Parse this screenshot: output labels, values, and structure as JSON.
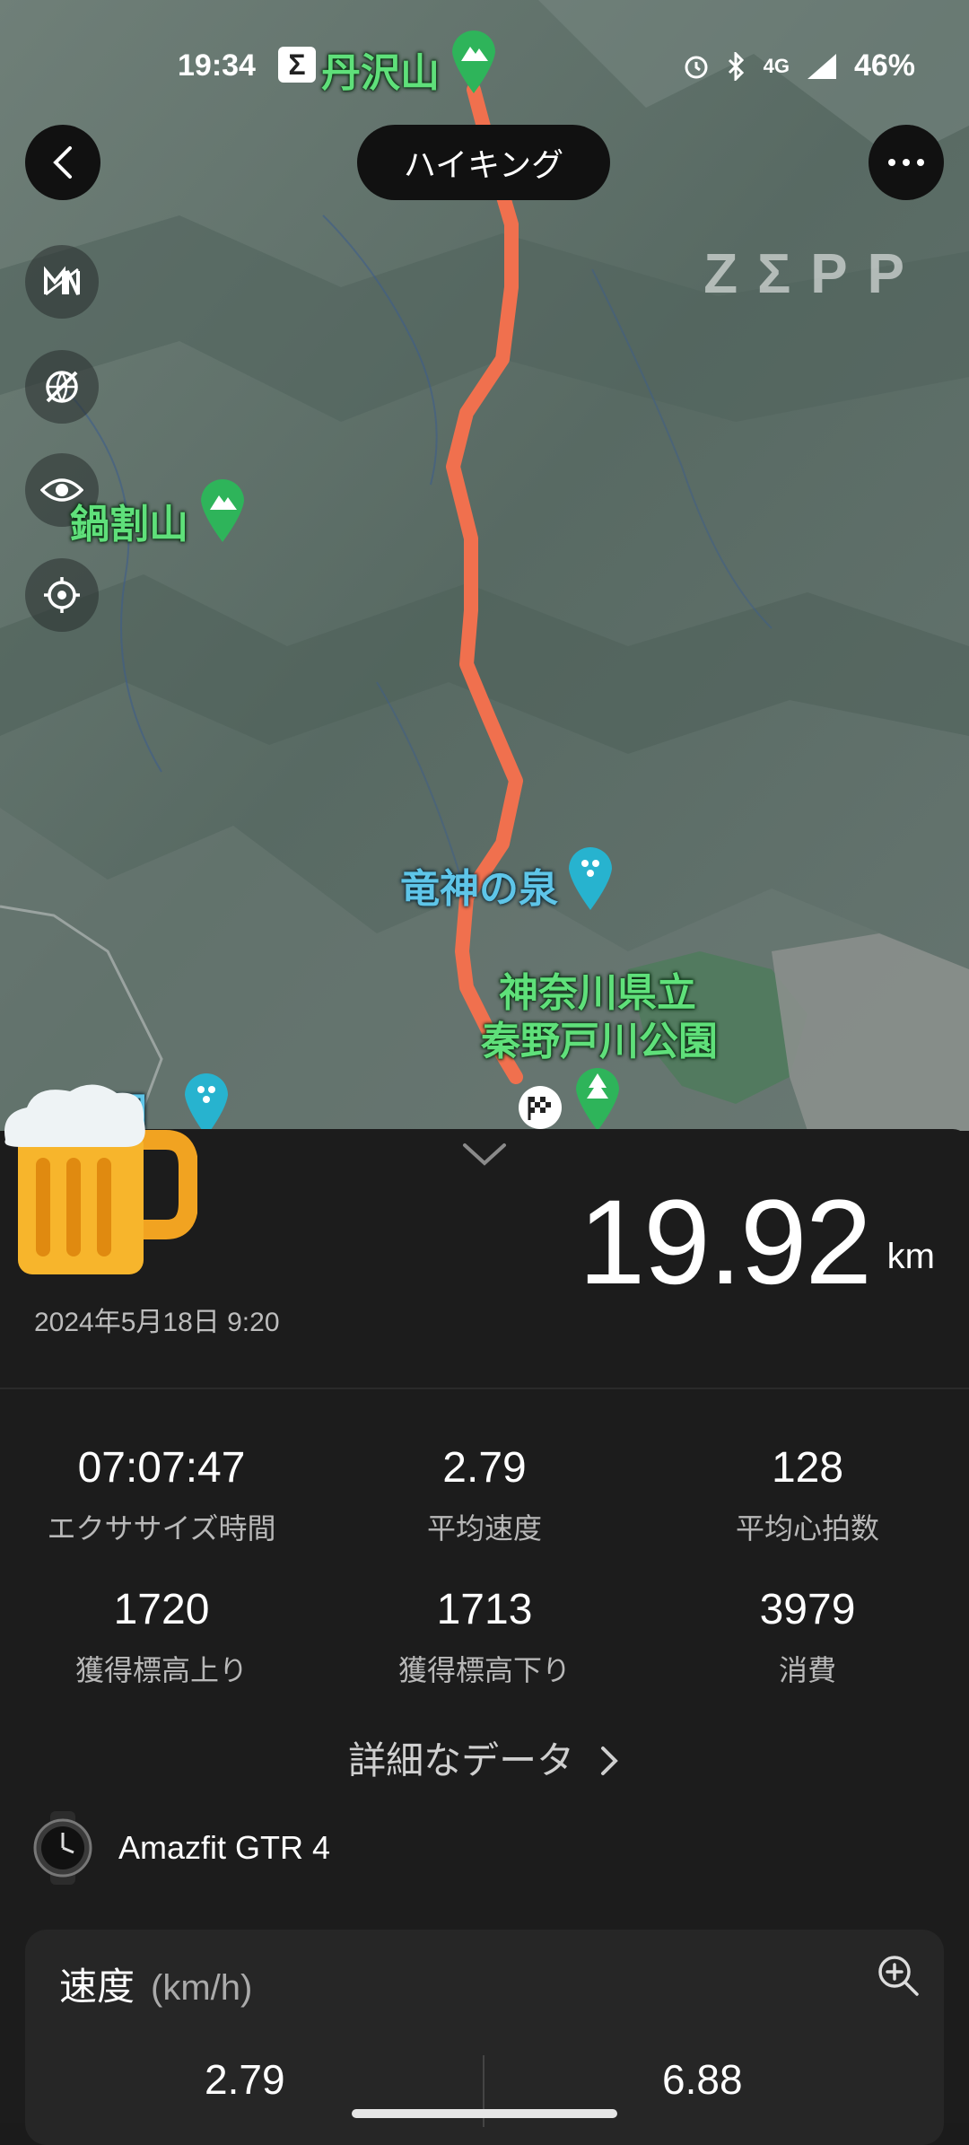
{
  "status_bar": {
    "time": "19:34",
    "notif_icon": "sigma-icon",
    "battery": "46%",
    "network": "4G"
  },
  "map": {
    "activity_title": "ハイキング",
    "watermark": "ZΣPP",
    "places": {
      "tanzawa": "丹沢山",
      "nabewari": "鍋割山",
      "ryujin": "竜神の泉",
      "park_line1": "神奈川県立",
      "park_line2": "秦野戸川公園",
      "left_partial": "園"
    },
    "route_color": "#f0704e"
  },
  "summary": {
    "distance": "19.92",
    "distance_unit": "km",
    "date": "2024年5月18日 9:20"
  },
  "stats": [
    {
      "value": "07:07:47",
      "label": "エクササイズ時間"
    },
    {
      "value": "2.79",
      "label": "平均速度"
    },
    {
      "value": "128",
      "label": "平均心拍数"
    },
    {
      "value": "1720",
      "label": "獲得標高上り"
    },
    {
      "value": "1713",
      "label": "獲得標高下り"
    },
    {
      "value": "3979",
      "label": "消費"
    }
  ],
  "detail_link": "詳細なデータ",
  "device": {
    "name": "Amazfit GTR 4"
  },
  "speed_card": {
    "title": "速度",
    "unit": "(km/h)",
    "avg": "2.79",
    "max": "6.88"
  }
}
